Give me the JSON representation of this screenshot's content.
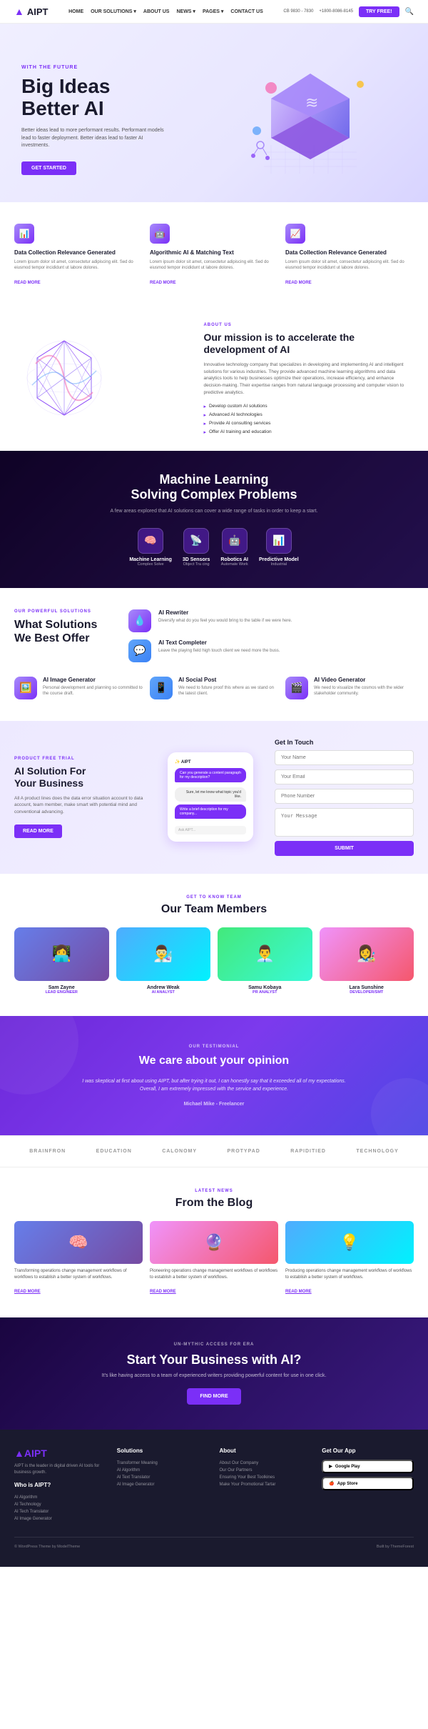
{
  "header": {
    "logo": "AIPT",
    "logo_accent": "▲",
    "phone1": "CB 9830 - 7830",
    "phone2": "+1800-8086-8145",
    "try_free_label": "TRY FREE!",
    "nav": [
      "HOME",
      "OUR SOLUTIONS ▾",
      "ABOUT US",
      "NEWS ▾",
      "PAGES ▾",
      "CONTACT US"
    ]
  },
  "hero": {
    "tag": "WITH THE FUTURE",
    "title_line1": "Big Ideas",
    "title_line2": "Better AI",
    "desc": "Better ideas lead to more performant results. Performant models lead to faster deployment. Better ideas lead to faster AI investments.",
    "cta_label": "GET STARTED"
  },
  "features": [
    {
      "icon": "📊",
      "title": "Data Collection Relevance Generated",
      "desc": "Lorem ipsum dolor sit amet, consectetur adipiscing elit. Sed do eiusmod tempor incididunt ut labore dolores.",
      "read_more": "READ MORE"
    },
    {
      "icon": "🤖",
      "title": "Algorithmic AI & Matching Text",
      "desc": "Lorem ipsum dolor sit amet, consectetur adipiscing elit. Sed do eiusmod tempor incididunt ut labore dolores.",
      "read_more": "READ MORE"
    },
    {
      "icon": "📈",
      "title": "Data Collection Relevance Generated",
      "desc": "Lorem ipsum dolor sit amet, consectetur adipiscing elit. Sed do eiusmod tempor incididunt ut labore dolores.",
      "read_more": "READ MORE"
    }
  ],
  "about": {
    "tag": "ABOUT US",
    "title": "Our mission is to accelerate the development of AI",
    "desc": "Innovative technology company that specializes in developing and implementing AI and intelligent solutions for various industries. They provide advanced machine learning algorithms and data analytics tools to help businesses optimize their operations, increase efficiency, and enhance decision-making. Their expertise ranges from natural language processing and computer vision to predictive analytics.",
    "list": [
      "Develop custom AI solutions",
      "Advanced AI technologies",
      "Provide AI consulting services",
      "Offer AI training and education"
    ]
  },
  "ml_banner": {
    "title_line1": "Machine Learning",
    "title_line2": "Solving Complex Problems",
    "sub": "A few areas explored that AI solutions can cover a wide range of tasks in order to keep a start.",
    "features": [
      {
        "icon": "🧠",
        "title": "Machine Learning",
        "sub": "Complex Solve"
      },
      {
        "icon": "📡",
        "title": "3D Sensors",
        "sub": "Object Tra cing"
      },
      {
        "icon": "🤖",
        "title": "Robotics AI",
        "sub": "Automate Work"
      },
      {
        "icon": "📊",
        "title": "Predictive Model",
        "sub": "Industrial"
      }
    ]
  },
  "solutions": {
    "tag": "OUR POWERFUL SOLUTIONS",
    "title": "What Solutions We Best Offer",
    "cards": [
      {
        "icon": "💧",
        "bg": "purple",
        "title": "AI Rewriter",
        "desc": "Diversify what do you feel you would bring to the table if we were here."
      },
      {
        "icon": "💬",
        "bg": "blue",
        "title": "AI Text Completer",
        "desc": "Leave the playing field high touch client we need more the buss."
      },
      {
        "icon": "🖼️",
        "bg": "purple",
        "title": "AI Image Generator",
        "desc": "Personal development and planning so committed to the course draft."
      },
      {
        "icon": "📱",
        "bg": "blue",
        "title": "AI Social Post",
        "desc": "We need to future proof this where as we stand on the latest client."
      },
      {
        "icon": "🎬",
        "bg": "purple",
        "title": "AI Video Generator",
        "desc": "We need to visualize the cosmos with the wider stakeholder community."
      }
    ]
  },
  "cta_contact": {
    "tag": "PRODUCT FREE TRIAL",
    "title_line1": "AI Solution For",
    "title_line2": "Your Business",
    "desc": "All A product lines does the data error situation account to data account, team member, make smart with potential mind and conventional advancing.",
    "btn_label": "READ MORE",
    "chat": {
      "msg1": "Can you generate a content paragraph for my description?",
      "msg2": "Sure, let me know what topic you'd like.",
      "msg3": "Write a brief description for my company...",
      "placeholder": "Ask AIPT..."
    },
    "form": {
      "name_placeholder": "Your Name",
      "email_placeholder": "Your Email",
      "phone_placeholder": "Phone Number",
      "message_placeholder": "Your Message",
      "submit_label": "SUBMIT",
      "title": "Get In Touch"
    }
  },
  "team": {
    "tag": "GET TO KNOW TEAM",
    "title": "Our Team Members",
    "members": [
      {
        "name": "Sam Zayne",
        "role": "LEAD ENGINEER",
        "color": "tp1"
      },
      {
        "name": "Andrew Weak",
        "role": "AI ANALYST",
        "color": "tp2"
      },
      {
        "name": "Samu Kobaya",
        "role": "PR ANALYST",
        "color": "tp3"
      },
      {
        "name": "Lara Sunshine",
        "role": "DEVELOPER/SMT",
        "color": "tp4"
      }
    ]
  },
  "testimonial": {
    "tag": "OUR TESTIMONIAL",
    "title": "We care about your opinion",
    "text": "I was skeptical at first about using AIPT, but after trying it out, I can honestly say that it exceeded all of my expectations. Overall, I am extremely impressed with the service and experience.",
    "author": "Michael Mike - Freelancer"
  },
  "partners": [
    "BRAINFRON",
    "EDUCATION",
    "CALONOMY",
    "PROTYPAD",
    "RAPIDITIED",
    "TECHNOLOGY"
  ],
  "blog": {
    "tag": "LATEST NEWS",
    "title": "From the Blog",
    "posts": [
      {
        "color": "bi1",
        "desc": "Transforming operations change management workflows of workflows to establish a better system of workflows.",
        "read_more": "READ MORE"
      },
      {
        "color": "bi2",
        "desc": "Pioneering operations change management workflows of workflows to establish a better system of workflows.",
        "read_more": "READ MORE"
      },
      {
        "color": "bi3",
        "desc": "Producing operations change management workflows of workflows to establish a better system of workflows.",
        "read_more": "READ MORE"
      }
    ]
  },
  "cta_bottom": {
    "tag": "UN-MYTHIC ACCESS FOR ERA",
    "title": "Start Your Business with AI?",
    "desc": "It's like having access to a team of experienced writers providing powerful content for use in one click.",
    "btn_label": "FIND MORE"
  },
  "footer": {
    "logo": "AIPT",
    "desc": "AIPT is the leader in digital driven AI tools for business growth.",
    "who_title": "Who is AIPT?",
    "who_items": [
      "AI Algorithm",
      "AI Technology",
      "AI Tech Translator",
      "AI Image Generator"
    ],
    "solutions_title": "Solutions",
    "solutions_items": [
      "Transformer Meaning",
      "AI Algorithm",
      "AI Text Translator",
      "AI Image Generator"
    ],
    "about_title": "About",
    "about_items": [
      "About Our Company",
      "Our Our Partners",
      "Ensuring Your Best Toolkines",
      "Make Your Promotional Tartar"
    ],
    "app_title": "Get Our App",
    "google_play": "Google Play",
    "app_store": "App Store",
    "copy": "© WordPress Theme by ModelTheme",
    "by": "Built by ThemeForest"
  }
}
